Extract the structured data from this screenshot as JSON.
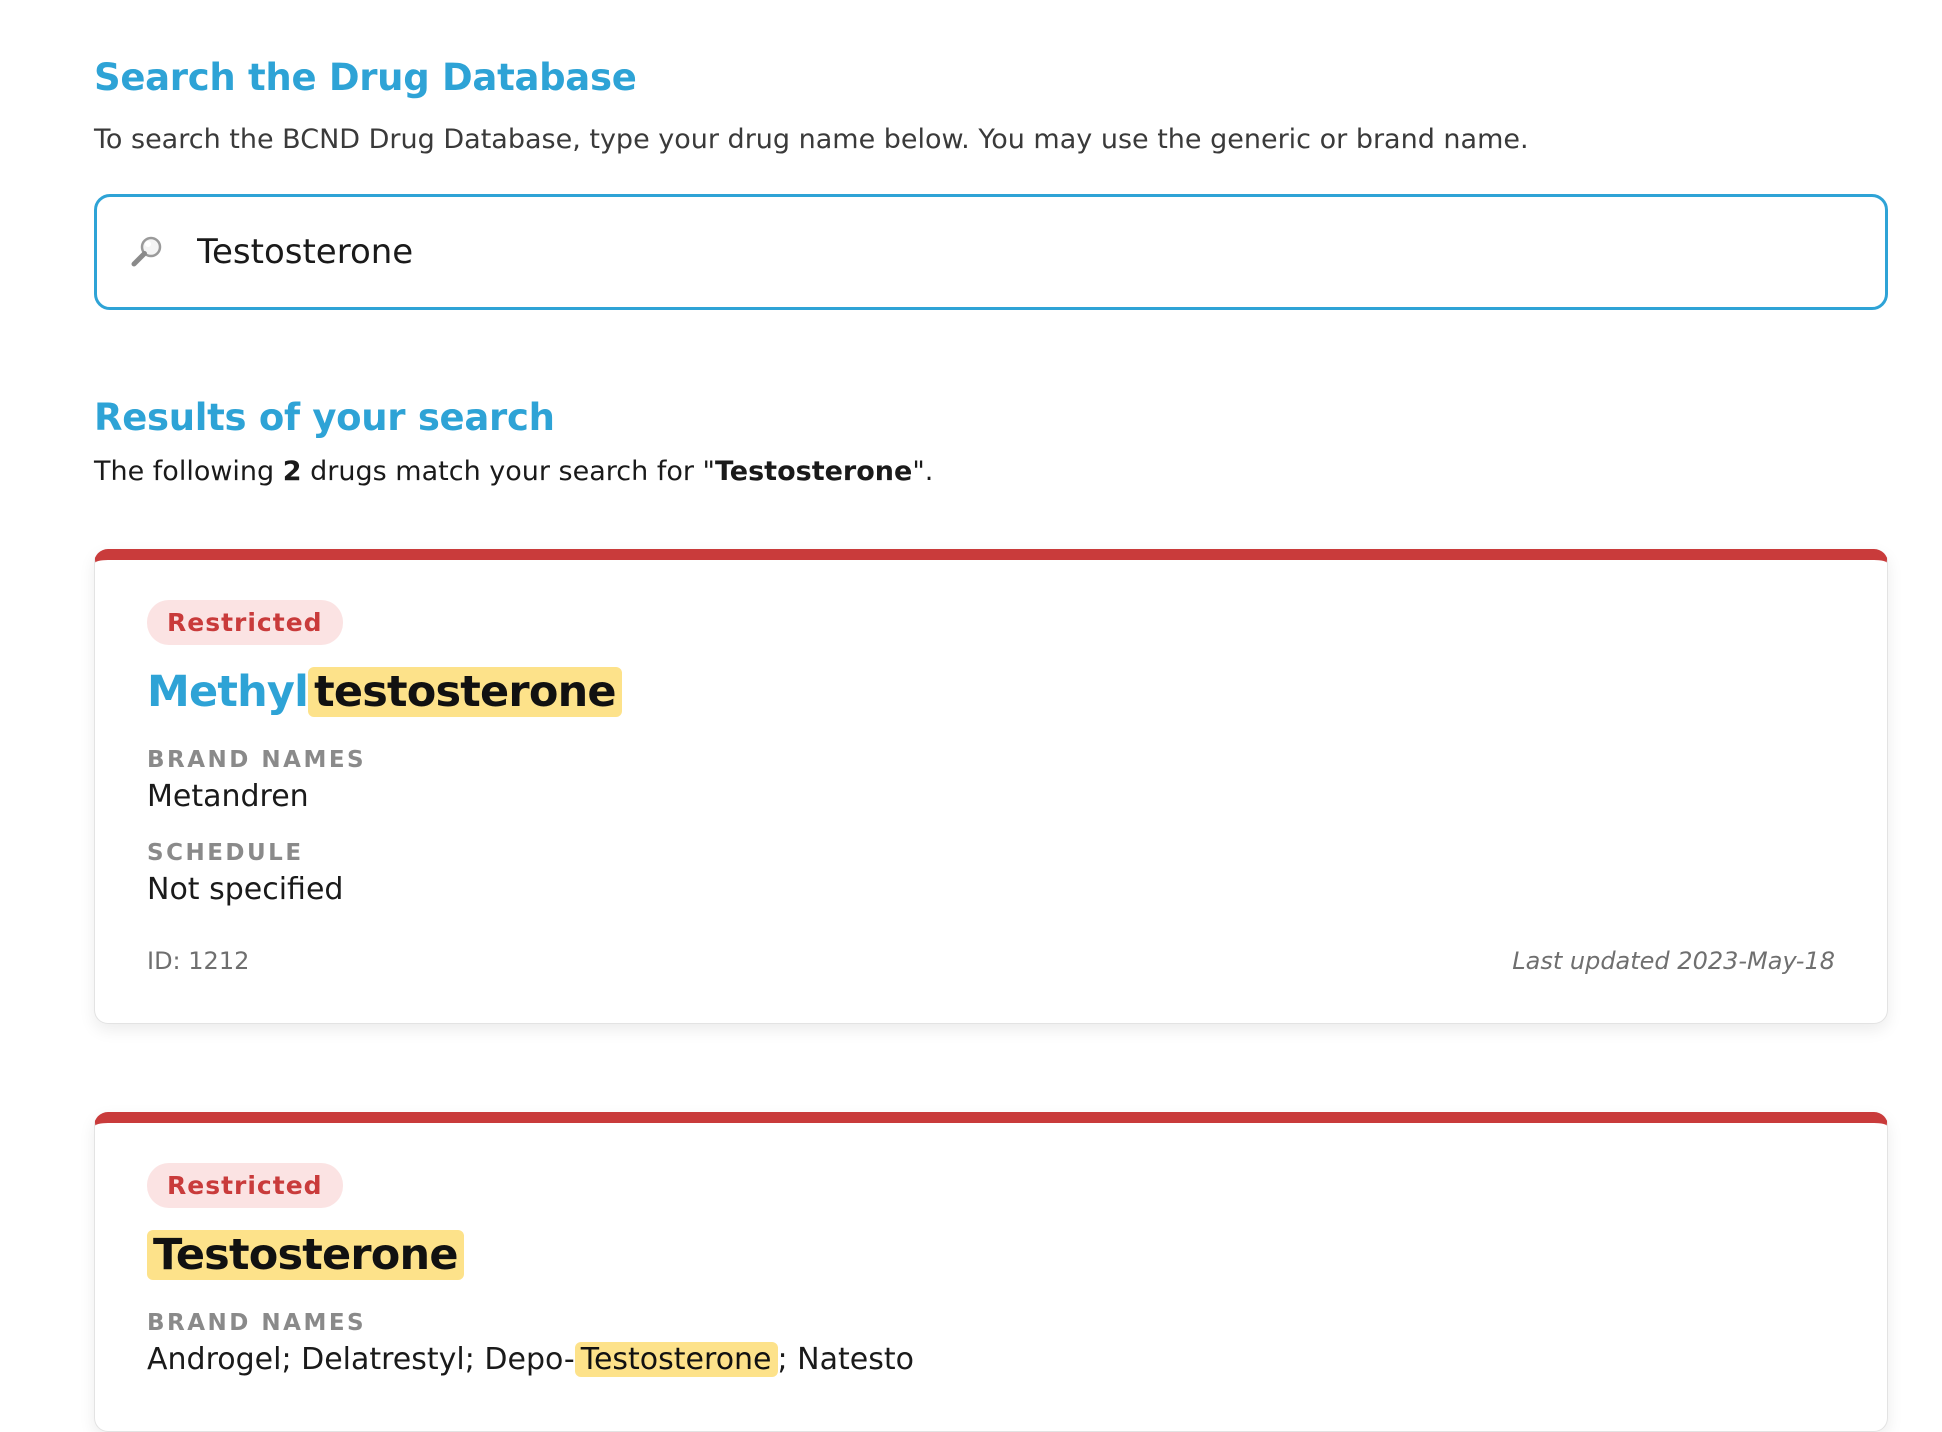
{
  "search_section": {
    "title": "Search the Drug Database",
    "intro": "To search the BCND Drug Database, type your drug name below. You may use the generic or brand name.",
    "query": "Testosterone",
    "icon": "magnifier-icon"
  },
  "results_section": {
    "title": "Results of your search",
    "summary_prefix": "The following ",
    "count": "2",
    "summary_middle": " drugs match your search for \"",
    "query": "Testosterone",
    "summary_suffix": "\"."
  },
  "results": [
    {
      "badge": "Restricted",
      "name_prefix": "Methyl",
      "name_match": "testosterone",
      "brand_label": "BRAND NAMES",
      "brand_names": "Metandren",
      "schedule_label": "SCHEDULE",
      "schedule": "Not specified",
      "id_text": "ID: 1212",
      "updated_text": "Last updated 2023-May-18"
    },
    {
      "badge": "Restricted",
      "name_match": "Testosterone",
      "brand_label": "BRAND NAMES",
      "brand_prefix": "Androgel; Delatrestyl; Depo-",
      "brand_match": "Testosterone",
      "brand_suffix": "; Natesto"
    }
  ],
  "colors": {
    "accent": "#2ea3d6",
    "restricted": "#c93b3b",
    "restricted_bg": "#fbe3e3",
    "highlight": "#fde28a"
  }
}
